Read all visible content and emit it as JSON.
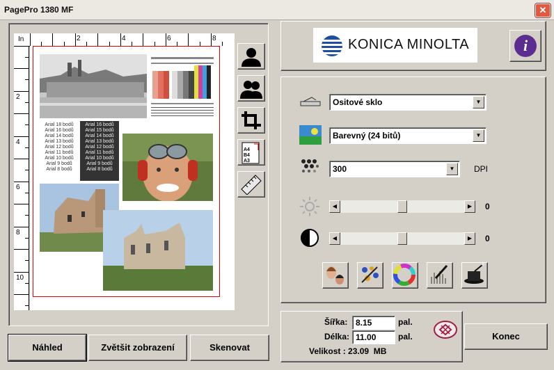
{
  "window": {
    "title": "PagePro 1380 MF",
    "close_icon": "close-icon"
  },
  "ruler": {
    "unit": "In",
    "top_labels": [
      "2",
      "4",
      "6",
      "8"
    ],
    "left_labels": [
      "2",
      "4",
      "6",
      "8",
      "10"
    ]
  },
  "preview": {
    "font_sample_light": [
      "Arial 18 bodů",
      "Arial 16 bodů",
      "Arial 14 bodů",
      "Arial 13 bodů",
      "Arial 12 bodů",
      "Arial 11 bodů",
      "Arial 10 bodů",
      "Arial 9 bodů",
      "Arial 8 bodů"
    ],
    "font_sample_dark": [
      "Arial 16 bodů",
      "Arial 15 bodů",
      "Arial 14 bodů",
      "Arial 13 bodů",
      "Arial 12 bodů",
      "Arial 11 bodů",
      "Arial 10 bodů",
      "Arial 9 bodů",
      "Arial 8 bodů"
    ]
  },
  "tools": [
    "person-icon",
    "two-persons-icon",
    "crop-icon",
    "paper-size-icon",
    "ruler-icon"
  ],
  "paper_size_labels": [
    "A4",
    "B4",
    "A3"
  ],
  "brand": {
    "logo_text": "KONICA MINOLTA",
    "logo_color": "#1d4ea3",
    "info_label": "i",
    "info_color": "#5c2d91"
  },
  "settings": {
    "source": "Ositové sklo",
    "mode": "Barevný (24 bitů)",
    "resolution": "300",
    "resolution_unit": "DPI",
    "brightness": "0",
    "contrast": "0",
    "brightness_level": 0.5,
    "contrast_level": 0.5
  },
  "filters": [
    "face-filter-icon",
    "descreen-icon",
    "color-wheel-icon",
    "dropper-icon",
    "magic-hat-icon"
  ],
  "size": {
    "width_label": "Šířka:",
    "width_value": "8.15",
    "width_unit": "pal.",
    "length_label": "Délka:",
    "length_value": "11.00",
    "length_unit": "pal.",
    "size_label": "Velikost : 23.09  MB"
  },
  "buttons": {
    "preview": "Náhled",
    "zoom": "Zvětšit zobrazení",
    "scan": "Skenovat",
    "close": "Konec"
  }
}
